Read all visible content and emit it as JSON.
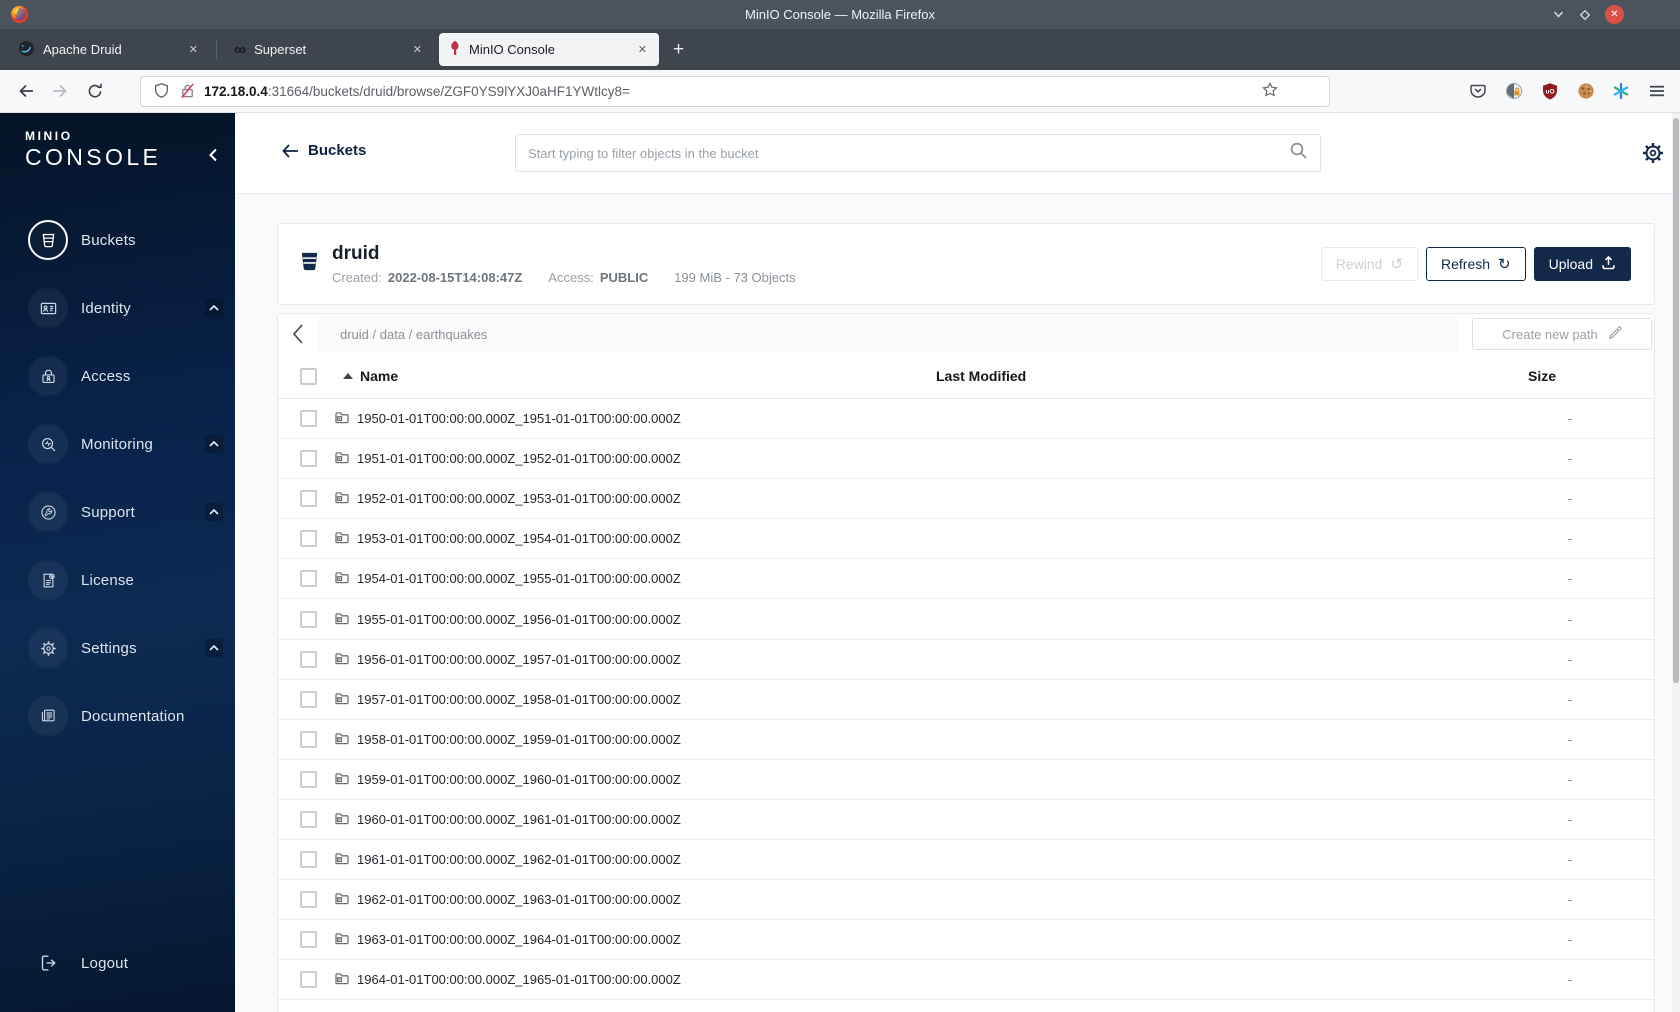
{
  "colors": {
    "navy": "#12294a",
    "minio_red": "#c72e49",
    "sidebar_top": "#041426",
    "sidebar_mid": "#0c2a52",
    "page_bg": "#fafafa"
  },
  "window": {
    "title": "MinIO Console — Mozilla Firefox"
  },
  "browser_tabs": {
    "tabs": [
      {
        "label": "Apache Druid"
      },
      {
        "label": "Superset"
      },
      {
        "label": "MinIO Console",
        "active": true
      }
    ],
    "close_glyph": "✕",
    "new_tab_glyph": "+"
  },
  "urlbar": {
    "host": "172.18.0.4",
    "path": ":31664/buckets/druid/browse/ZGF0YS9lYXJ0aHF1YWtlcy8="
  },
  "sidebar": {
    "logo_small": "MINIO",
    "logo_large": "CONSOLE",
    "items": [
      {
        "label": "Buckets",
        "selected": true,
        "expandable": false
      },
      {
        "label": "Identity",
        "expandable": true
      },
      {
        "label": "Access",
        "expandable": false
      },
      {
        "label": "Monitoring",
        "expandable": true
      },
      {
        "label": "Support",
        "expandable": true
      },
      {
        "label": "License",
        "expandable": false
      },
      {
        "label": "Settings",
        "expandable": true
      },
      {
        "label": "Documentation",
        "expandable": false
      }
    ],
    "logout_label": "Logout"
  },
  "page_header": {
    "back_label": "Buckets",
    "search_placeholder": "Start typing to filter objects in the bucket"
  },
  "bucket": {
    "name": "druid",
    "created_label": "Created:",
    "created_value": "2022-08-15T14:08:47Z",
    "access_label": "Access:",
    "access_value": "PUBLIC",
    "summary": "199 MiB - 73 Objects"
  },
  "actions": {
    "rewind": "Rewind",
    "rewind_glyph": "↺",
    "refresh": "Refresh",
    "refresh_glyph": "↻",
    "upload": "Upload",
    "create_path": "Create new path"
  },
  "path_bar": {
    "path": "druid / data / earthquakes"
  },
  "table": {
    "headers": {
      "name": "Name",
      "last_modified": "Last Modified",
      "size": "Size"
    },
    "rows": [
      {
        "name": "1950-01-01T00:00:00.000Z_1951-01-01T00:00:00.000Z",
        "size": "-"
      },
      {
        "name": "1951-01-01T00:00:00.000Z_1952-01-01T00:00:00.000Z",
        "size": "-"
      },
      {
        "name": "1952-01-01T00:00:00.000Z_1953-01-01T00:00:00.000Z",
        "size": "-"
      },
      {
        "name": "1953-01-01T00:00:00.000Z_1954-01-01T00:00:00.000Z",
        "size": "-"
      },
      {
        "name": "1954-01-01T00:00:00.000Z_1955-01-01T00:00:00.000Z",
        "size": "-"
      },
      {
        "name": "1955-01-01T00:00:00.000Z_1956-01-01T00:00:00.000Z",
        "size": "-"
      },
      {
        "name": "1956-01-01T00:00:00.000Z_1957-01-01T00:00:00.000Z",
        "size": "-"
      },
      {
        "name": "1957-01-01T00:00:00.000Z_1958-01-01T00:00:00.000Z",
        "size": "-"
      },
      {
        "name": "1958-01-01T00:00:00.000Z_1959-01-01T00:00:00.000Z",
        "size": "-"
      },
      {
        "name": "1959-01-01T00:00:00.000Z_1960-01-01T00:00:00.000Z",
        "size": "-"
      },
      {
        "name": "1960-01-01T00:00:00.000Z_1961-01-01T00:00:00.000Z",
        "size": "-"
      },
      {
        "name": "1961-01-01T00:00:00.000Z_1962-01-01T00:00:00.000Z",
        "size": "-"
      },
      {
        "name": "1962-01-01T00:00:00.000Z_1963-01-01T00:00:00.000Z",
        "size": "-"
      },
      {
        "name": "1963-01-01T00:00:00.000Z_1964-01-01T00:00:00.000Z",
        "size": "-"
      },
      {
        "name": "1964-01-01T00:00:00.000Z_1965-01-01T00:00:00.000Z",
        "size": "-"
      }
    ]
  }
}
